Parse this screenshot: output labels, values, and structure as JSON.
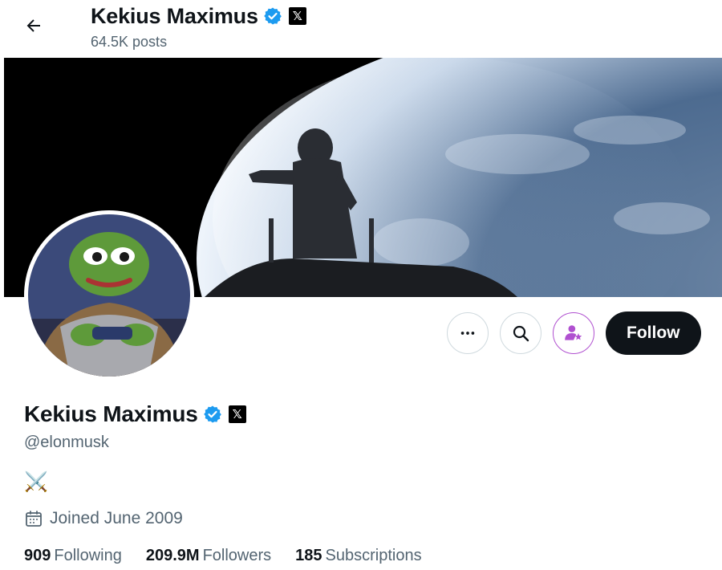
{
  "header": {
    "title": "Kekius Maximus",
    "posts": "64.5K posts",
    "back_icon": "arrow-left-icon"
  },
  "profile": {
    "name": "Kekius Maximus",
    "handle": "@elonmusk",
    "bio": "⚔️",
    "joined": "Joined June 2009",
    "verified_color": "#1d9bf0",
    "affiliate_badge": "𝕏"
  },
  "actions": {
    "more_icon": "more-horizontal-icon",
    "search_icon": "search-icon",
    "subscribe_icon": "subscribe-user-star-icon",
    "follow_label": "Follow"
  },
  "stats": {
    "following": {
      "count": "909",
      "label": "Following"
    },
    "followers": {
      "count": "209.9M",
      "label": "Followers"
    },
    "subscriptions": {
      "count": "185",
      "label": "Subscriptions"
    }
  },
  "colors": {
    "text": "#0f1419",
    "secondary": "#536471",
    "subscribe_accent": "#b050d0"
  }
}
